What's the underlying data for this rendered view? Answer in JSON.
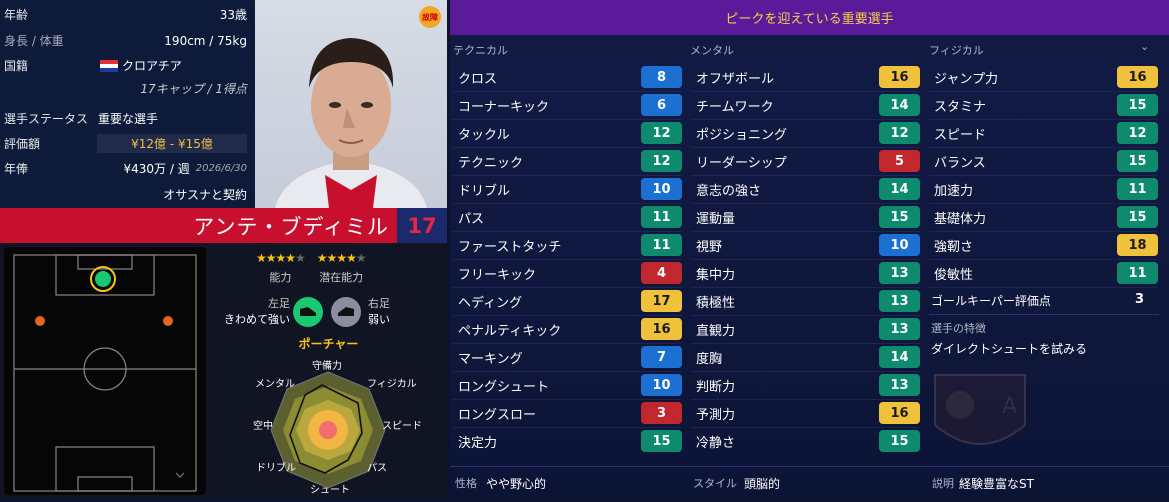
{
  "info": {
    "age_label": "年齢",
    "age_value": "33歳",
    "hw_label": "身長 / 体重",
    "hw_value": "190cm / 75kg",
    "nat_label": "国籍",
    "nat_value": "クロアチア",
    "caps_value": "17キャップ / 1得点",
    "status_label": "選手ステータス",
    "status_value": "重要な選手",
    "val_label": "評価額",
    "val_value": "¥12億 - ¥15億",
    "wage_label": "年俸",
    "wage_value": "¥430万 / 週",
    "wage_date": "2026/6/30",
    "contract": "オサスナと契約"
  },
  "injury_badge": "故障",
  "player": {
    "name": "アンテ・ブディミル",
    "number": "17"
  },
  "ratings": {
    "ability_label": "能力",
    "potential_label": "潜在能力",
    "ability_stars": 4,
    "potential_stars": 4
  },
  "feet": {
    "left_label": "左足",
    "left_value": "きわめて強い",
    "right_label": "右足",
    "right_value": "弱い"
  },
  "role": "ポーチャー",
  "radar_labels": {
    "top": "守備力",
    "top_right": "フィジカル",
    "right": "スピード",
    "bottom_right": "パス",
    "bottom": "シュート",
    "bottom_left": "ドリブル",
    "left": "空中",
    "top_left": "メンタル"
  },
  "banner": "ピークを迎えている重要選手",
  "columns": {
    "technical": "テクニカル",
    "mental": "メンタル",
    "physical": "フィジカル"
  },
  "technical": [
    {
      "name": "クロス",
      "value": 8,
      "color": "blue"
    },
    {
      "name": "コーナーキック",
      "value": 6,
      "color": "blue"
    },
    {
      "name": "タックル",
      "value": 12,
      "color": "teal"
    },
    {
      "name": "テクニック",
      "value": 12,
      "color": "teal"
    },
    {
      "name": "ドリブル",
      "value": 10,
      "color": "blue"
    },
    {
      "name": "パス",
      "value": 11,
      "color": "teal"
    },
    {
      "name": "ファーストタッチ",
      "value": 11,
      "color": "teal"
    },
    {
      "name": "フリーキック",
      "value": 4,
      "color": "red"
    },
    {
      "name": "ヘディング",
      "value": 17,
      "color": "yellow"
    },
    {
      "name": "ペナルティキック",
      "value": 16,
      "color": "yellow"
    },
    {
      "name": "マーキング",
      "value": 7,
      "color": "blue"
    },
    {
      "name": "ロングシュート",
      "value": 10,
      "color": "blue"
    },
    {
      "name": "ロングスロー",
      "value": 3,
      "color": "red"
    },
    {
      "name": "決定力",
      "value": 15,
      "color": "teal"
    }
  ],
  "mental": [
    {
      "name": "オフザボール",
      "value": 16,
      "color": "yellow"
    },
    {
      "name": "チームワーク",
      "value": 14,
      "color": "teal"
    },
    {
      "name": "ポジショニング",
      "value": 12,
      "color": "teal"
    },
    {
      "name": "リーダーシップ",
      "value": 5,
      "color": "red"
    },
    {
      "name": "意志の強さ",
      "value": 14,
      "color": "teal"
    },
    {
      "name": "運動量",
      "value": 15,
      "color": "teal"
    },
    {
      "name": "視野",
      "value": 10,
      "color": "blue"
    },
    {
      "name": "集中力",
      "value": 13,
      "color": "teal"
    },
    {
      "name": "積極性",
      "value": 13,
      "color": "teal"
    },
    {
      "name": "直観力",
      "value": 13,
      "color": "teal"
    },
    {
      "name": "度胸",
      "value": 14,
      "color": "teal"
    },
    {
      "name": "判断力",
      "value": 13,
      "color": "teal"
    },
    {
      "name": "予測力",
      "value": 16,
      "color": "yellow"
    },
    {
      "name": "冷静さ",
      "value": 15,
      "color": "teal"
    }
  ],
  "physical": [
    {
      "name": "ジャンプ力",
      "value": 16,
      "color": "yellow"
    },
    {
      "name": "スタミナ",
      "value": 15,
      "color": "teal"
    },
    {
      "name": "スピード",
      "value": 12,
      "color": "teal"
    },
    {
      "name": "バランス",
      "value": 15,
      "color": "teal"
    },
    {
      "name": "加速力",
      "value": 11,
      "color": "teal"
    },
    {
      "name": "基礎体力",
      "value": 15,
      "color": "teal"
    },
    {
      "name": "強靭さ",
      "value": 18,
      "color": "yellow"
    },
    {
      "name": "俊敏性",
      "value": 11,
      "color": "teal"
    }
  ],
  "gk_rating": {
    "label": "ゴールキーパー評価点",
    "value": "3"
  },
  "traits": {
    "label": "選手の特徴",
    "value": "ダイレクトシュートを試みる"
  },
  "bottom": {
    "personality_label": "性格",
    "personality_value": "やや野心的",
    "style_label": "スタイル",
    "style_value": "頭脳的",
    "desc_label": "説明",
    "desc_value": "経験豊富なST"
  }
}
